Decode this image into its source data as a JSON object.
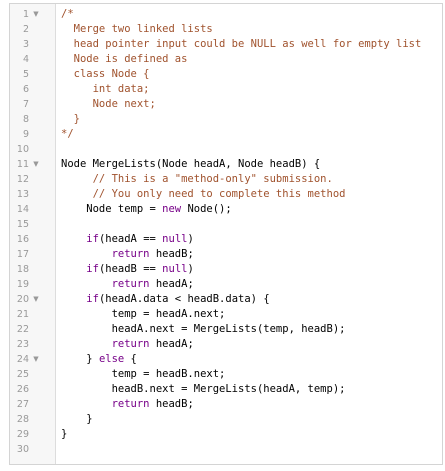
{
  "editor": {
    "fold_marker": "▼",
    "lines": [
      {
        "n": "1",
        "fold": true,
        "text": "/*",
        "kind": "comment"
      },
      {
        "n": "2",
        "fold": false,
        "text": "  Merge two linked lists",
        "kind": "comment"
      },
      {
        "n": "3",
        "fold": false,
        "text": "  head pointer input could be NULL as well for empty list",
        "kind": "comment"
      },
      {
        "n": "4",
        "fold": false,
        "text": "  Node is defined as",
        "kind": "comment"
      },
      {
        "n": "5",
        "fold": false,
        "text": "  class Node {",
        "kind": "comment"
      },
      {
        "n": "6",
        "fold": false,
        "text": "     int data;",
        "kind": "comment"
      },
      {
        "n": "7",
        "fold": false,
        "text": "     Node next;",
        "kind": "comment"
      },
      {
        "n": "8",
        "fold": false,
        "text": "  }",
        "kind": "comment"
      },
      {
        "n": "9",
        "fold": false,
        "text": "*/",
        "kind": "comment"
      },
      {
        "n": "10",
        "fold": false,
        "text": "",
        "kind": "code"
      },
      {
        "n": "11",
        "fold": true,
        "text": "Node MergeLists(Node headA, Node headB) {",
        "kind": "code"
      },
      {
        "n": "12",
        "fold": false,
        "text": "     // This is a \"method-only\" submission.",
        "kind": "comment"
      },
      {
        "n": "13",
        "fold": false,
        "text": "     // You only need to complete this method",
        "kind": "comment"
      },
      {
        "n": "14",
        "fold": false,
        "text": "    Node temp = new Node();",
        "kind": "code"
      },
      {
        "n": "15",
        "fold": false,
        "text": "",
        "kind": "code"
      },
      {
        "n": "16",
        "fold": false,
        "text": "    if(headA == null)",
        "kind": "code"
      },
      {
        "n": "17",
        "fold": false,
        "text": "        return headB;",
        "kind": "code"
      },
      {
        "n": "18",
        "fold": false,
        "text": "    if(headB == null)",
        "kind": "code"
      },
      {
        "n": "19",
        "fold": false,
        "text": "        return headA;",
        "kind": "code"
      },
      {
        "n": "20",
        "fold": true,
        "text": "    if(headA.data < headB.data) {",
        "kind": "code"
      },
      {
        "n": "21",
        "fold": false,
        "text": "        temp = headA.next;",
        "kind": "code"
      },
      {
        "n": "22",
        "fold": false,
        "text": "        headA.next = MergeLists(temp, headB);",
        "kind": "code"
      },
      {
        "n": "23",
        "fold": false,
        "text": "        return headA;",
        "kind": "code"
      },
      {
        "n": "24",
        "fold": true,
        "text": "    } else {",
        "kind": "code"
      },
      {
        "n": "25",
        "fold": false,
        "text": "        temp = headB.next;",
        "kind": "code"
      },
      {
        "n": "26",
        "fold": false,
        "text": "        headB.next = MergeLists(headA, temp);",
        "kind": "code"
      },
      {
        "n": "27",
        "fold": false,
        "text": "        return headB;",
        "kind": "code"
      },
      {
        "n": "28",
        "fold": false,
        "text": "    }",
        "kind": "code"
      },
      {
        "n": "29",
        "fold": false,
        "text": "}",
        "kind": "code"
      },
      {
        "n": "30",
        "fold": false,
        "text": "",
        "kind": "code"
      }
    ]
  },
  "colors": {
    "comment": "#a0522d",
    "keyword": "#770088",
    "gutter_bg": "#f7f7f7",
    "line_number": "#999999"
  }
}
